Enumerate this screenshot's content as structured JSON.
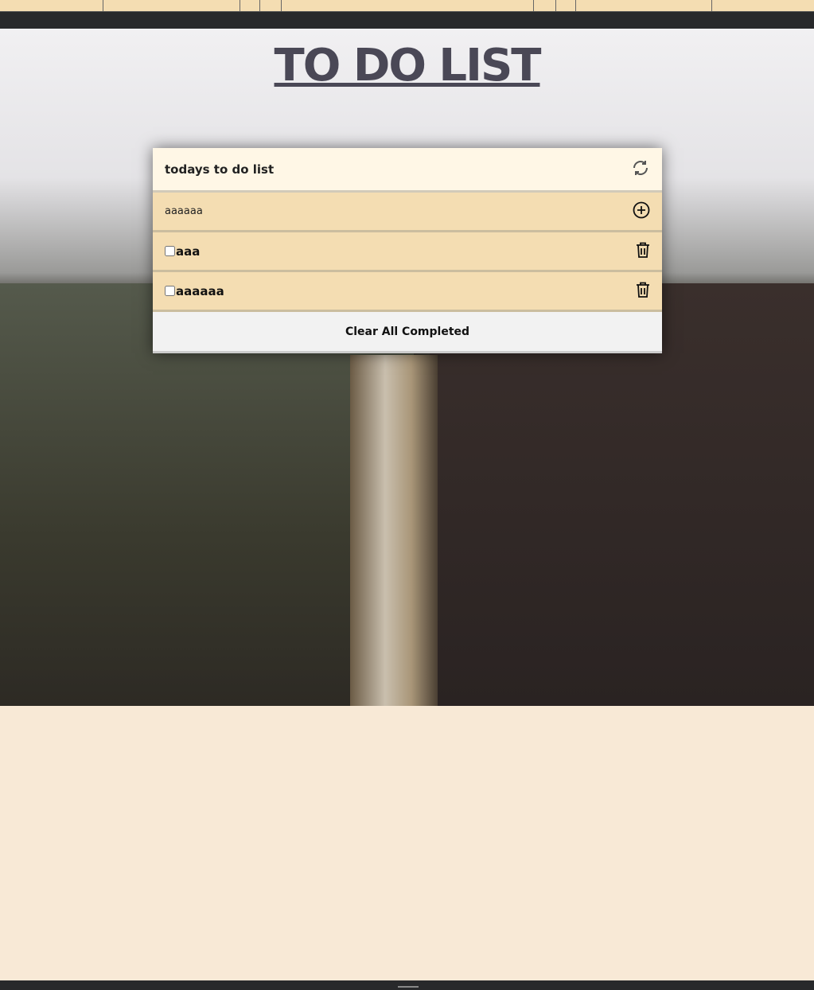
{
  "title": "TO DO LIST",
  "card": {
    "header": "todays to do list",
    "input_value": "aaaaaa",
    "items": [
      {
        "label": "aaa",
        "checked": false
      },
      {
        "label": "aaaaaa",
        "checked": false
      }
    ],
    "clear_label": "Clear All Completed"
  }
}
